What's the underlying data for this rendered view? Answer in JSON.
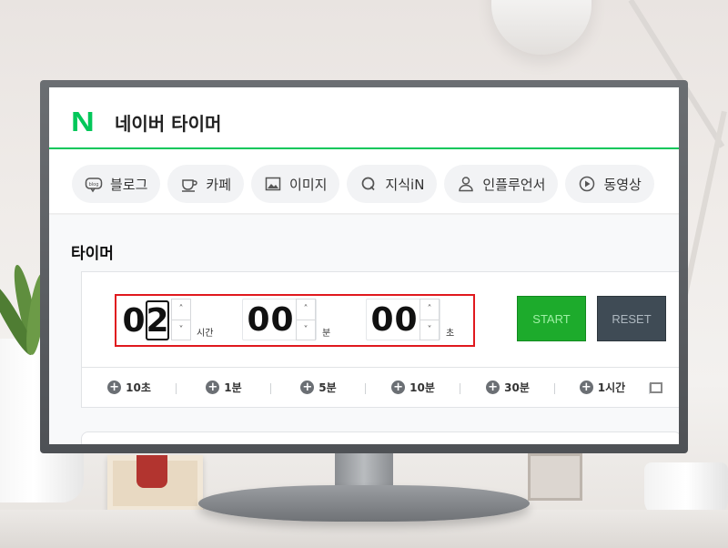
{
  "app": {
    "title": "네이버 타이머",
    "logo": "N",
    "brand_color": "#03c75a"
  },
  "nav": {
    "items": [
      {
        "label": "블로그",
        "icon": "blog-icon"
      },
      {
        "label": "카페",
        "icon": "cup-icon"
      },
      {
        "label": "이미지",
        "icon": "image-icon"
      },
      {
        "label": "지식iN",
        "icon": "q-icon"
      },
      {
        "label": "인플루언서",
        "icon": "person-icon"
      },
      {
        "label": "동영상",
        "icon": "play-icon"
      }
    ]
  },
  "timer": {
    "section_title": "타이머",
    "hours": {
      "d1": "0",
      "d2": "2",
      "label": "시간"
    },
    "minutes": {
      "d1": "0",
      "d2": "0",
      "label": "분"
    },
    "seconds": {
      "d1": "0",
      "d2": "0",
      "label": "초"
    },
    "stepper_up": "˄",
    "stepper_down": "˅",
    "start_label": "START",
    "reset_label": "RESET",
    "highlight_color": "#e0191e",
    "start_color": "#1dab2c",
    "reset_color": "#3f4b55"
  },
  "quick_add": {
    "items": [
      "10초",
      "1분",
      "5분",
      "10분",
      "30분",
      "1시간"
    ]
  }
}
